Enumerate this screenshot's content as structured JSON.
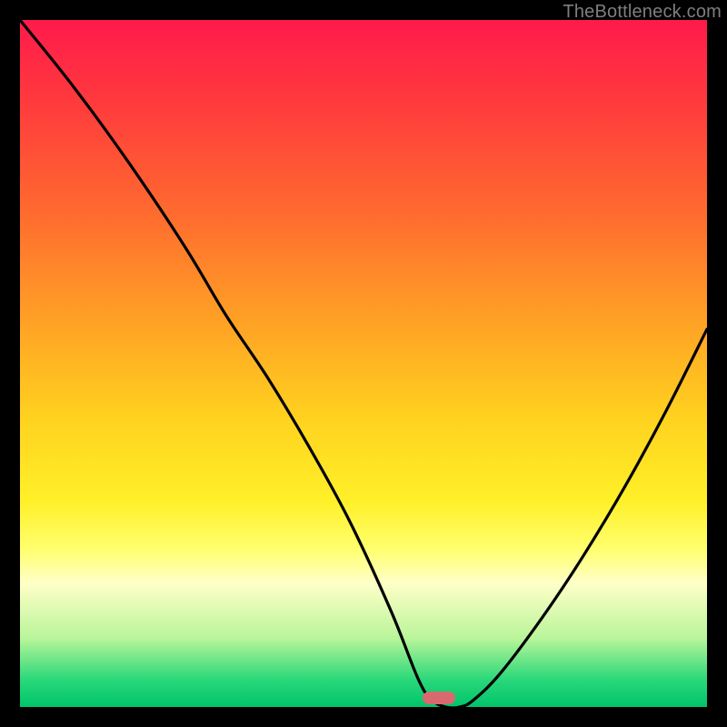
{
  "watermark": "TheBottleneck.com",
  "marker": {
    "x_frac": 0.61,
    "y_frac": 0.987
  },
  "chart_data": {
    "type": "line",
    "title": "",
    "xlabel": "",
    "ylabel": "",
    "xlim": [
      0,
      100
    ],
    "ylim": [
      0,
      100
    ],
    "background_gradient": {
      "top": "#ff1a4b",
      "middle": "#ffd21f",
      "bottom": "#00c46a"
    },
    "marker": {
      "x": 61.0,
      "color": "#d86a6f"
    },
    "series": [
      {
        "name": "bottleneck-curve",
        "color": "#000000",
        "x": [
          0,
          8,
          16,
          24,
          30,
          36,
          42,
          48,
          54,
          58,
          60,
          62,
          64,
          66,
          70,
          76,
          82,
          88,
          94,
          100
        ],
        "values": [
          100,
          90,
          79,
          67,
          57,
          48,
          38,
          27,
          14,
          4,
          1,
          0,
          0,
          1,
          5,
          13,
          22,
          32,
          43,
          55
        ]
      }
    ]
  }
}
